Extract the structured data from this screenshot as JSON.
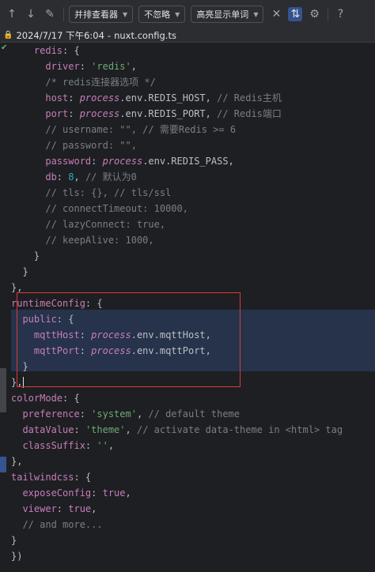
{
  "toolbar": {
    "viewer_mode": "并排查看器",
    "ignore_mode": "不忽略",
    "highlight_mode": "高亮显示单词"
  },
  "header": {
    "timestamp": "2024/7/17 下午6:04",
    "separator": "-",
    "filename": "nuxt.config.ts"
  },
  "code_lines": [
    [
      [
        "k",
        "    redis"
      ],
      [
        "p",
        ": {"
      ]
    ],
    [
      [
        "k",
        "      driver"
      ],
      [
        "p",
        ": "
      ],
      [
        "s",
        "'redis'"
      ],
      [
        "p",
        ","
      ]
    ],
    [
      [
        "c",
        "      /* redis连接器选项 */"
      ]
    ],
    [
      [
        "k",
        "      host"
      ],
      [
        "p",
        ": "
      ],
      [
        "it",
        "process"
      ],
      [
        "p",
        ".env.REDIS_HOST, "
      ],
      [
        "c",
        "// Redis主机"
      ]
    ],
    [
      [
        "k",
        "      port"
      ],
      [
        "p",
        ": "
      ],
      [
        "it",
        "process"
      ],
      [
        "p",
        ".env.REDIS_PORT, "
      ],
      [
        "c",
        "// Redis端口"
      ]
    ],
    [
      [
        "c",
        "      // username: \"\", // 需要Redis >= 6"
      ]
    ],
    [
      [
        "c",
        "      // password: \"\","
      ]
    ],
    [
      [
        "k",
        "      password"
      ],
      [
        "p",
        ": "
      ],
      [
        "it",
        "process"
      ],
      [
        "p",
        ".env.REDIS_PASS,"
      ]
    ],
    [
      [
        "k",
        "      db"
      ],
      [
        "p",
        ": "
      ],
      [
        "n",
        "8"
      ],
      [
        "p",
        ", "
      ],
      [
        "c",
        "// 默认为0"
      ]
    ],
    [
      [
        "c",
        "      // tls: {}, // tls/ssl"
      ]
    ],
    [
      [
        "c",
        "      // connectTimeout: 10000,"
      ]
    ],
    [
      [
        "c",
        "      // lazyConnect: true,"
      ]
    ],
    [
      [
        "c",
        "      // keepAlive: 1000,"
      ]
    ],
    [
      [
        "p",
        "    }"
      ]
    ],
    [
      [
        "p",
        "  }"
      ]
    ],
    [
      [
        "p",
        "},"
      ]
    ],
    [
      [
        "k",
        "runtimeConfig"
      ],
      [
        "p",
        ": {"
      ]
    ],
    [
      [
        "k",
        "  public"
      ],
      [
        "p",
        ": {"
      ]
    ],
    [
      [
        "k",
        "    mqttHost"
      ],
      [
        "p",
        ": "
      ],
      [
        "it",
        "process"
      ],
      [
        "p",
        ".env.mqttHost,"
      ]
    ],
    [
      [
        "k",
        "    mqttPort"
      ],
      [
        "p",
        ": "
      ],
      [
        "it",
        "process"
      ],
      [
        "p",
        ".env.mqttPort,"
      ]
    ],
    [
      [
        "p",
        "  }"
      ]
    ],
    [
      [
        "p",
        "},"
      ]
    ],
    [
      [
        "k",
        "colorMode"
      ],
      [
        "p",
        ": {"
      ]
    ],
    [
      [
        "k",
        "  preference"
      ],
      [
        "p",
        ": "
      ],
      [
        "s",
        "'system'"
      ],
      [
        "p",
        ", "
      ],
      [
        "c",
        "// default theme"
      ]
    ],
    [
      [
        "k",
        "  dataValue"
      ],
      [
        "p",
        ": "
      ],
      [
        "s",
        "'theme'"
      ],
      [
        "p",
        ", "
      ],
      [
        "c",
        "// activate data-theme in <html> tag"
      ]
    ],
    [
      [
        "k",
        "  classSuffix"
      ],
      [
        "p",
        ": "
      ],
      [
        "s",
        "''"
      ],
      [
        "p",
        ","
      ]
    ],
    [
      [
        "p",
        "},"
      ]
    ],
    [
      [
        "k",
        "tailwindcss"
      ],
      [
        "p",
        ": {"
      ]
    ],
    [
      [
        "k",
        "  exposeConfig"
      ],
      [
        "p",
        ": "
      ],
      [
        "k",
        "true"
      ],
      [
        "p",
        ","
      ]
    ],
    [
      [
        "k",
        "  viewer"
      ],
      [
        "p",
        ": "
      ],
      [
        "k",
        "true"
      ],
      [
        "p",
        ","
      ]
    ],
    [
      [
        "c",
        "  // and more..."
      ]
    ],
    [
      [
        "p",
        "}"
      ]
    ],
    [
      [
        "p",
        "})"
      ]
    ]
  ]
}
